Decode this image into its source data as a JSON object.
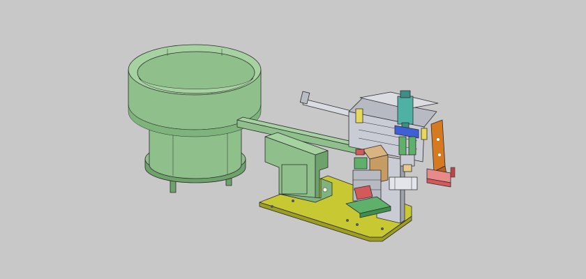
{
  "scene": {
    "background": "#c8c8c8",
    "colors": {
      "feeder_green": "#8fc08c",
      "feeder_green_dark": "#6ea26b",
      "feeder_green_light": "#a6d2a2",
      "base_plate": "#c8c832",
      "base_plate_dark": "#9d9d22",
      "steel": "#c9ccd4",
      "steel_dark": "#9ea2ab",
      "cylinder_teal": "#4fb0a4",
      "cylinder_blue": "#3f5fd6",
      "bracket_orange": "#d67a1f",
      "part_red": "#d45a5a",
      "part_pink": "#e98a8a",
      "block_tan": "#d9b481",
      "block_green": "#5fb06a",
      "accent_yellow": "#e6d85a"
    }
  }
}
